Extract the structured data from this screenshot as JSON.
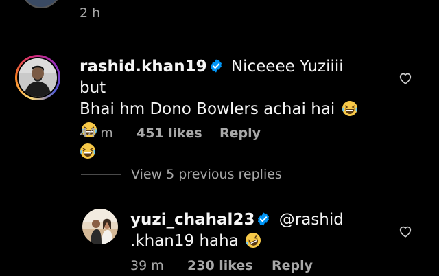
{
  "previous_comment": {
    "time": "2 h"
  },
  "comment": {
    "username": "rashid.khan19",
    "verified": true,
    "text_line1": "Niceeee Yuziiii but",
    "text_line2": "Bhai hm Dono Bowlers achai hai",
    "emoji": "grinning-squinting-face",
    "time": "44 m",
    "likes": "451 likes",
    "reply_label": "Reply"
  },
  "view_replies": {
    "label": "View 5 previous replies"
  },
  "reply": {
    "username": "yuzi_chahal23",
    "verified": true,
    "mention_part1": "@rashid",
    "mention_part2": ".khan19",
    "text": "haha",
    "emoji": "rolling-on-floor-laughing",
    "time": "39 m",
    "likes": "230 likes",
    "reply_label": "Reply"
  },
  "colors": {
    "background": "#000000",
    "text": "#f5f5f5",
    "muted": "#a8a8a8",
    "verified": "#0095f6"
  }
}
